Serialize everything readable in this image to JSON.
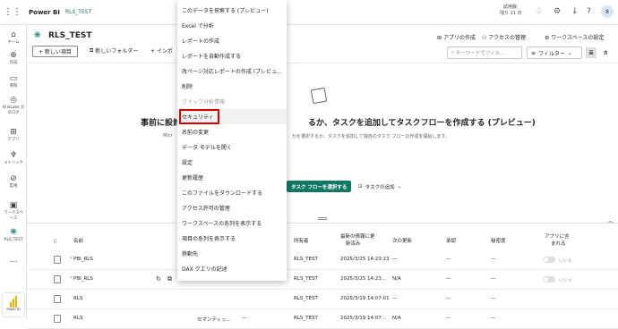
{
  "topbar": {
    "app": "Power BI",
    "workspace": "RLS_TEST",
    "trial": "試用版:",
    "trial_days": "残り 11 日",
    "avatar": "8",
    "icons": [
      "bell-icon",
      "gear-icon",
      "download-icon",
      "help-icon",
      "share-icon"
    ]
  },
  "nav": {
    "items": [
      {
        "icon": "home-icon",
        "label": "ホーム"
      },
      {
        "icon": "plus-icon",
        "label": "作成"
      },
      {
        "icon": "folder-icon",
        "label": "参照"
      },
      {
        "icon": "onelake-icon",
        "label": "OneLake カ"
      },
      {
        "icon": "onelake-icon-2",
        "label": "タログ"
      },
      {
        "icon": "apps-icon",
        "label": "アプリ"
      },
      {
        "icon": "trophy-icon",
        "label": "メトリック"
      },
      {
        "icon": "monitor-icon",
        "label": "監視"
      },
      {
        "icon": "workspaces-icon",
        "label": "ワークスペ"
      },
      {
        "icon": "workspaces-icon-2",
        "label": "ース"
      },
      {
        "icon": "rls-icon",
        "label": "RLS_TEST"
      },
      {
        "icon": "more-icon",
        "label": "..."
      }
    ],
    "pbi_label": "Power BI"
  },
  "header": {
    "title": "RLS_TEST",
    "new_item": "+ 新しい項目",
    "new_folder": "新しいフォルダー",
    "import": "+ インポ",
    "create_app": "アプリの作成",
    "manage_access": "アクセスの管理",
    "ws_settings": "ワークスペースの設定",
    "search_placeholder": "キーワードでフィル...",
    "filter": "フィルター"
  },
  "empty": {
    "headline_left": "事前に設計",
    "headline_right": "るか、タスクを追加してタスクフローを作成する (プレビュー)",
    "sub_left": "Micr",
    "sub_right": "かを選択するか、タスクを追加して独自のタスク フローの作成を開始します。",
    "flow_btn": "タスク フローを選択する",
    "add_task": "タスクの追加"
  },
  "table": {
    "headers": {
      "name": "名前",
      "owner": "所有者",
      "refreshed": "最新の情報に更",
      "refreshed2": "新済み",
      "next": "次の更新",
      "endorse": "承認",
      "sensitivity": "秘密度",
      "inapp": "アプリに含",
      "inapp2": "まれる"
    },
    "rows": [
      {
        "name": "PBI_RLS",
        "type": "",
        "owner": "RLS_TEST",
        "refreshed": "2025/3/25 14:23:23",
        "next": "—",
        "endorse": "—",
        "sensitivity": "—",
        "toggle": "いいえ"
      },
      {
        "name": "PBI_RLS",
        "type": "",
        "owner": "RLS_TEST",
        "refreshed": "2025/3/25 14:23...",
        "next": "N/A",
        "endorse": "—",
        "sensitivity": "—",
        "toggle": "いいえ"
      },
      {
        "name": "RLS",
        "type": "",
        "owner": "RLS_TEST",
        "refreshed": "2025/3/19 14:07:01",
        "next": "—",
        "endorse": "—",
        "sensitivity": "—",
        "toggle": ""
      },
      {
        "name": "RLS",
        "type": "セマンティッ...",
        "owner": "RLS_TEST",
        "refreshed": "2025/3/19 14:07...",
        "next": "N/A",
        "endorse": "—",
        "sensitivity": "—",
        "toggle": ""
      }
    ]
  },
  "menu": {
    "items": [
      "このデータを探索する (プレビュー)",
      "Excel で分析",
      "レポートの作成",
      "レポートを自動作成する",
      "改ページ対応レポートの作成 (プレビュ...",
      "削除",
      "クイック分析情報",
      "セキュリティ",
      "名前の変更",
      "データ モデルを開く",
      "設定",
      "更新履歴",
      "このファイルをダウンロードする",
      "アクセス許可の管理",
      "ワークスペースの系列を表示する",
      "項目の系列を表示する",
      "移動先",
      "DAX クエリの記述"
    ]
  },
  "colors": {
    "accent": "#117865",
    "highlight_box": "#d00000"
  }
}
